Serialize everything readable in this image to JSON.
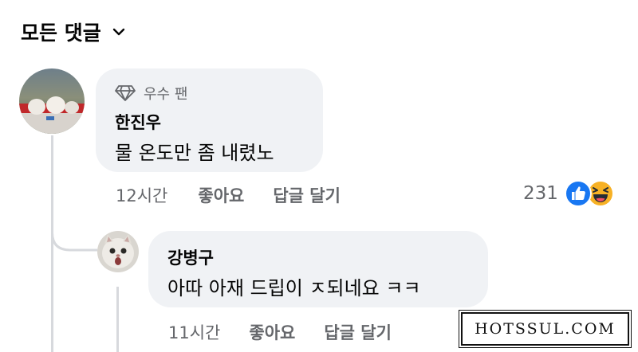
{
  "header": {
    "title": "모든 댓글",
    "dropdown_icon": "chevron-down-icon"
  },
  "comments": [
    {
      "badge": "우수 팬",
      "badge_icon": "diamond-icon",
      "author": "한진우",
      "text": "물 온도만 좀 내렸노",
      "time": "12시간",
      "like_label": "좋아요",
      "reply_label": "답글 달기",
      "reaction_count": "231",
      "reactions": [
        "like-reaction-icon",
        "haha-reaction-icon"
      ]
    },
    {
      "author": "강병구",
      "text": "아따 아재 드립이 ㅈ되네요 ㅋㅋ",
      "time": "11시간",
      "like_label": "좋아요",
      "reply_label": "답글 달기"
    }
  ],
  "watermark": "HOTSSUL.COM",
  "colors": {
    "bubble": "#f0f2f5",
    "secondary_text": "#65676b",
    "like_blue": "#1877f2",
    "haha_yellow": "#f7b125"
  }
}
